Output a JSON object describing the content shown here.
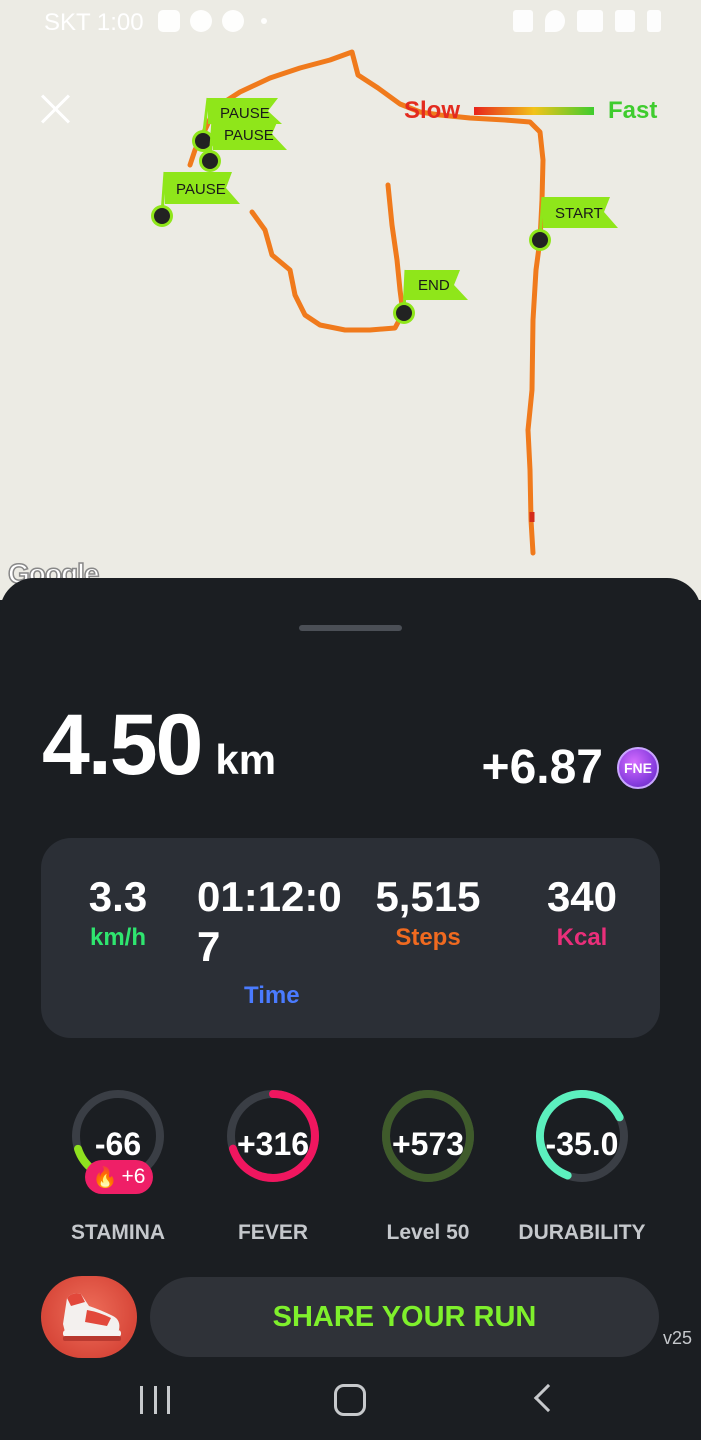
{
  "status_bar": {
    "carrier_time": "SKT 1:00"
  },
  "map": {
    "legend": {
      "slow": "Slow",
      "fast": "Fast"
    },
    "markers": {
      "pause_1": "PAUSE",
      "pause_2": "PAUSE",
      "pause_3": "PAUSE",
      "start": "START",
      "end": "END"
    },
    "attribution": "Google"
  },
  "summary": {
    "distance_value": "4.50",
    "distance_unit": "km",
    "reward": "+6.87",
    "token_label": "FNE"
  },
  "stats": {
    "speed": {
      "value": "3.3",
      "label": "km/h"
    },
    "time": {
      "value": "01:12:07",
      "label": "Time"
    },
    "steps": {
      "value": "5,515",
      "label": "Steps"
    },
    "kcal": {
      "value": "340",
      "label": "Kcal"
    }
  },
  "gauges": {
    "stamina": {
      "value": "-66",
      "label": "STAMINA",
      "badge": "+6",
      "fill": 0.2,
      "color": "#8fe01f"
    },
    "fever": {
      "value": "+316",
      "label": "FEVER",
      "fill": 0.7,
      "color": "#f0165f"
    },
    "level": {
      "value": "+573",
      "label": "Level 50",
      "fill": 1.0,
      "color": "#3f5b2b"
    },
    "durability": {
      "value": "-35.0",
      "label": "DURABILITY",
      "fill": 0.62,
      "color": "#5cf0be"
    }
  },
  "share": {
    "label": "SHARE YOUR RUN"
  },
  "version": "v25"
}
